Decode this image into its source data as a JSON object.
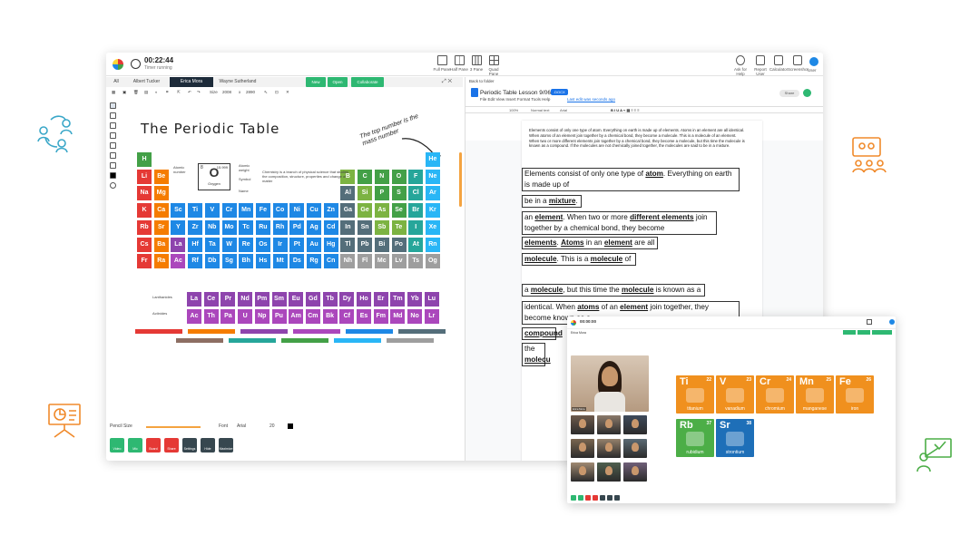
{
  "header": {
    "timer": "00:22:44",
    "timer_sub": "Timer running",
    "layouts": [
      "Full Pane",
      "Half Pane",
      "3 Pane",
      "Quad Pane"
    ],
    "tools": [
      "Ask for Help",
      "Report User",
      "Calculator",
      "Screenshot",
      "User"
    ]
  },
  "tabs": [
    "All",
    "Albert Tucker",
    "Erica Mora",
    "Wayne Sutherland"
  ],
  "actions": {
    "new": "New",
    "open": "Open",
    "collaborate": "Collaborate"
  },
  "whiteboard": {
    "size_label": "Size",
    "size_w": "2008",
    "size_x": "x",
    "size_h": "2890",
    "title": "The Periodic Table",
    "annotation": "The top number is the mass number",
    "selected": {
      "number": "8",
      "symbol": "O",
      "name": "Oxygen",
      "mass": "15.999"
    },
    "selected_labels": {
      "atomic_number": "Atomic number",
      "atomic_weight": "Atomic weight",
      "symbol": "Symbol",
      "name": "Name"
    },
    "description": "Chemistry is a branch of physical science that studies the composition, structure, properties and change of matter",
    "lanthanides_label": "Lanthanides",
    "actinides_label": "Actinides",
    "pencil_label": "Pencil Size",
    "font_label": "Font",
    "font_value": "Arial",
    "font_size": "20"
  },
  "elements_colors": {
    "alkali": "#e53935",
    "alkaline": "#f57c00",
    "transition": "#1e88e5",
    "post": "#546e7a",
    "metalloid": "#7cb342",
    "nonmetal": "#43a047",
    "halogen": "#26a69a",
    "noble": "#29b6f6",
    "lanth": "#8e44ad",
    "act": "#ab47bc",
    "hydrogen": "#43a047",
    "other": "#9e9e9e"
  },
  "bottom_buttons": [
    "Video",
    "Mic",
    "Board",
    "Share",
    "Settings",
    "Hide",
    "Maximize"
  ],
  "document": {
    "back": "Back to folder",
    "title": "Periodic Table Lesson 9/06/21",
    "badge": ".DOCX",
    "menu": "File   Edit   View   Insert   Format   Tools   Help",
    "edit_note": "Last edit was seconds ago",
    "share": "Share",
    "zoom": "100%",
    "style": "Normal text",
    "font": "Arial",
    "small_text": "Elements consist of only one type of atom. Everything on earth is made up of elements. Atoms in an element are all identical. When atoms of an element join together by a chemical bond, they become a molecule. This is a molecule of an element. When two or more different elements join together by a chemical bond, they become a molecule, but this time the molecule is known as a compound. If the molecules are not chemically joined together, the molecules are said to be in a mixture.",
    "boxes": [
      [
        "Elements consist of only one type of ",
        "atom",
        ". Everything on earth is made up of"
      ],
      [
        "be in a ",
        "mixture",
        "."
      ],
      [
        "an ",
        "element",
        ". When two or more ",
        "different elements",
        " join together by a chemical bond, they become"
      ],
      [
        "elements",
        ". ",
        "Atoms",
        " in an ",
        "element",
        " are all"
      ],
      [
        "molecule",
        ". This is a ",
        "molecule",
        " of"
      ],
      [
        "a ",
        "molecule",
        ", but this time the ",
        "molecule",
        " is known as a"
      ],
      [
        "identical. When ",
        "atoms",
        " of an ",
        "element",
        " join together, they become known as a"
      ],
      [
        "compound"
      ],
      [
        "the ",
        "molecu"
      ]
    ]
  },
  "overlay": {
    "timer": "00:00:00",
    "panel_title": "Erica Mora",
    "main_video_label": "Erica Mora",
    "cards": [
      {
        "symbol": "Ti",
        "number": "22",
        "name": "titanium",
        "color": "#f0901e"
      },
      {
        "symbol": "V",
        "number": "23",
        "name": "vanadium",
        "color": "#f0901e"
      },
      {
        "symbol": "Cr",
        "number": "24",
        "name": "chromium",
        "color": "#f0901e"
      },
      {
        "symbol": "Mn",
        "number": "25",
        "name": "manganese",
        "color": "#f0901e"
      },
      {
        "symbol": "Fe",
        "number": "26",
        "name": "iron",
        "color": "#f0901e"
      },
      {
        "symbol": "Rb",
        "number": "37",
        "name": "rubidium",
        "color": "#4cae47"
      },
      {
        "symbol": "Sr",
        "number": "38",
        "name": "strontium",
        "color": "#1e6fb8"
      }
    ]
  }
}
